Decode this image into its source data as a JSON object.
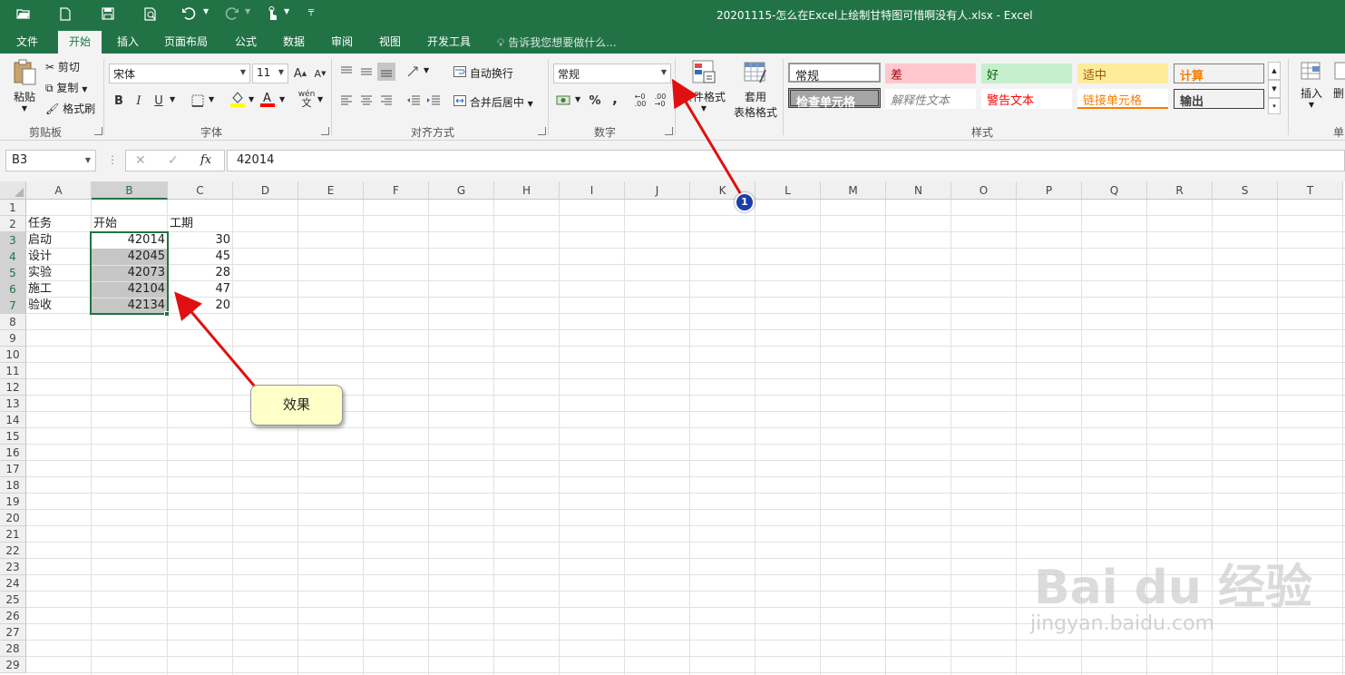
{
  "window": {
    "title": "20201115-怎么在Excel上绘制甘特图可惜啊没有人.xlsx  -  Excel"
  },
  "quick_access": {
    "icons": [
      "open-icon",
      "new-icon",
      "save-icon",
      "print-preview-icon",
      "undo-icon",
      "redo-icon",
      "touch-mode-icon",
      "customize-icon"
    ]
  },
  "tabs": [
    {
      "label": "文件"
    },
    {
      "label": "开始"
    },
    {
      "label": "插入"
    },
    {
      "label": "页面布局"
    },
    {
      "label": "公式"
    },
    {
      "label": "数据"
    },
    {
      "label": "审阅"
    },
    {
      "label": "视图"
    },
    {
      "label": "开发工具"
    }
  ],
  "tell_me": "告诉我您想要做什么...",
  "ribbon": {
    "clipboard": {
      "paste": "粘贴",
      "cut": "剪切",
      "copy": "复制",
      "format_painter": "格式刷",
      "label": "剪贴板"
    },
    "font": {
      "font_name": "宋体",
      "font_size": "11",
      "bold": "B",
      "italic": "I",
      "underline": "U",
      "label": "字体"
    },
    "alignment": {
      "wrap_text": "自动换行",
      "merge_center": "合并后居中",
      "label": "对齐方式"
    },
    "number": {
      "format": "常规",
      "percent": "%",
      "comma": ",",
      "label": "数字"
    },
    "conditional": {
      "label": "条件格式"
    },
    "table_format": {
      "label_line1": "套用",
      "label_line2": "表格格式"
    },
    "styles": {
      "items": [
        {
          "label": "常规",
          "fg": "#222222",
          "bg": "#ffffff"
        },
        {
          "label": "差",
          "fg": "#9c0006",
          "bg": "#ffc7ce"
        },
        {
          "label": "好",
          "fg": "#006100",
          "bg": "#c6efce"
        },
        {
          "label": "适中",
          "fg": "#9c5700",
          "bg": "#ffeb9c"
        },
        {
          "label": "计算",
          "fg": "#fa7d00",
          "bg": "#f2f2f2"
        },
        {
          "label": "检查单元格",
          "fg": "#ffffff",
          "bg": "#a5a5a5"
        },
        {
          "label": "解释性文本",
          "fg": "#7f7f7f",
          "bg": "#ffffff"
        },
        {
          "label": "警告文本",
          "fg": "#ff0000",
          "bg": "#ffffff"
        },
        {
          "label": "链接单元格",
          "fg": "#fa7d00",
          "bg": "#ffffff"
        },
        {
          "label": "输出",
          "fg": "#3f3f3f",
          "bg": "#f2f2f2"
        }
      ],
      "label": "样式"
    },
    "cells": {
      "insert": "插入",
      "delete_partial": "删"
    },
    "cells_group_label_partial": "单"
  },
  "formula_bar": {
    "name_box": "B3",
    "cancel": "✕",
    "enter": "✓",
    "fx": "fx",
    "value": "42014"
  },
  "sheet": {
    "columns": [
      "A",
      "B",
      "C",
      "D",
      "E",
      "F",
      "G",
      "H",
      "I",
      "J",
      "K",
      "L",
      "M",
      "N",
      "O",
      "P",
      "Q",
      "R",
      "S",
      "T"
    ],
    "rows": [
      "1",
      "2",
      "3",
      "4",
      "5",
      "6",
      "7",
      "8",
      "9",
      "10",
      "11",
      "12",
      "13",
      "14",
      "15",
      "16",
      "17",
      "18",
      "19",
      "20",
      "21",
      "22",
      "23",
      "24",
      "25",
      "26",
      "27",
      "28",
      "29"
    ],
    "selected_column": "B",
    "header_row": {
      "a": "任务",
      "b": "开始",
      "c": "工期"
    },
    "data": [
      {
        "task": "启动",
        "start": "42014",
        "duration": "30"
      },
      {
        "task": "设计",
        "start": "42045",
        "duration": "45"
      },
      {
        "task": "实验",
        "start": "42073",
        "duration": "28"
      },
      {
        "task": "施工",
        "start": "42104",
        "duration": "47"
      },
      {
        "task": "验收",
        "start": "42134",
        "duration": "20"
      }
    ]
  },
  "annotations": {
    "callout": "效果",
    "badge": "1",
    "arrow_color": "#e01010"
  },
  "watermark": {
    "brand": "Bai du 经验",
    "url": "jingyan.baidu.com"
  }
}
